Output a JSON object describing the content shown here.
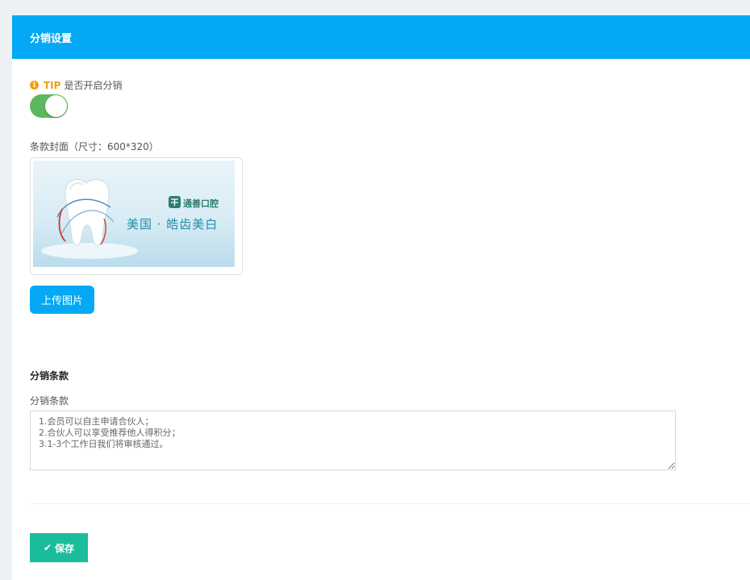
{
  "header": {
    "title": "分销设置"
  },
  "tip": {
    "icon": "info-icon",
    "label": "TIP",
    "text": "是否开启分销"
  },
  "toggle": {
    "enabled": true,
    "color": "#5cb85c"
  },
  "cover": {
    "label": "条款封面（尺寸：600*320）",
    "logo_text": "通善口腔",
    "slogan": "美国 · 皓齿美白"
  },
  "upload": {
    "label": "上传图片"
  },
  "terms": {
    "section_title": "分销条款",
    "field_label": "分销条款",
    "value": "1.会员可以自主申请合伙人；\n2.合伙人可以享受推荐他人得积分；\n3.1-3个工作日我们将审核通过。"
  },
  "save": {
    "icon": "check-icon",
    "label": "保存"
  },
  "colors": {
    "header": "#03a9f4",
    "tip": "#f39c12",
    "save": "#1abc9c"
  }
}
